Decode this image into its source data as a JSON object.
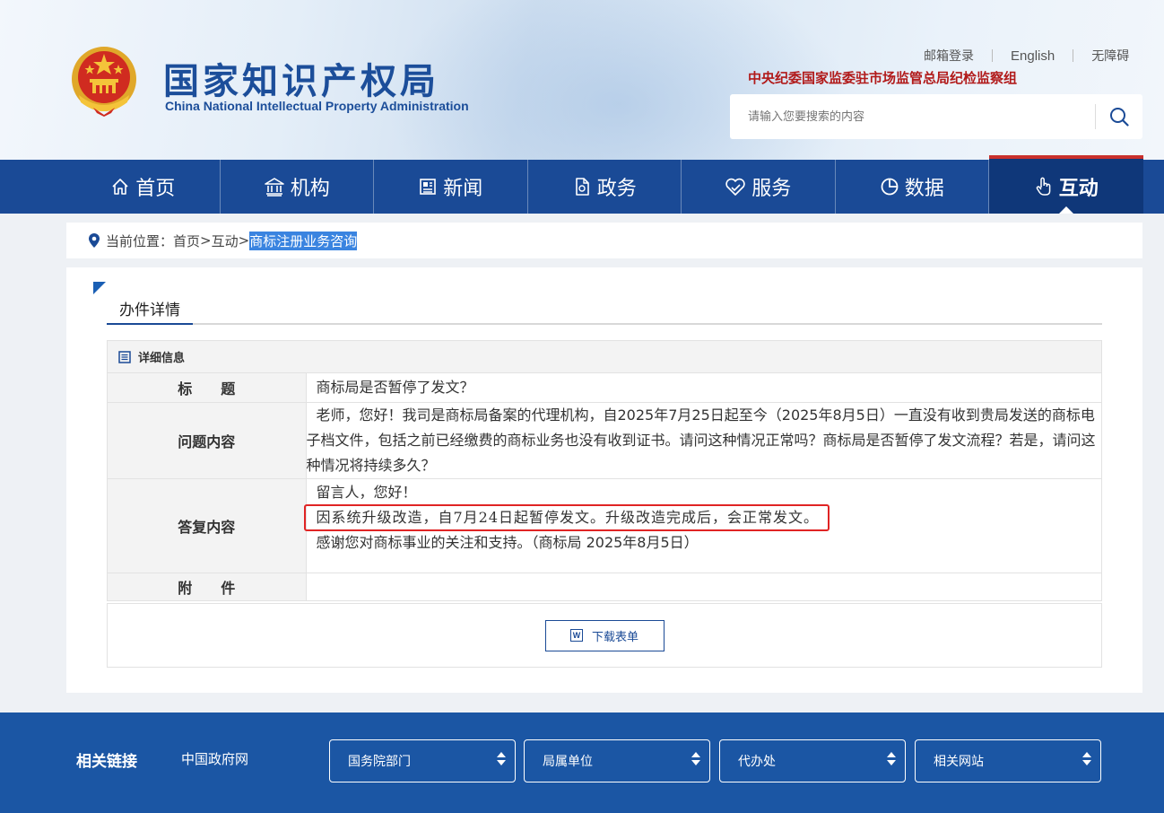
{
  "header": {
    "logo_cn": "国家知识产权局",
    "logo_en": "China National Intellectual Property Administration",
    "top_links": [
      "邮箱登录",
      "English",
      "无障碍"
    ],
    "discipline_group": "中央纪委国家监委驻市场监管总局纪检监察组",
    "search_placeholder": "请输入您要搜索的内容"
  },
  "nav": {
    "items": [
      {
        "label": "首页",
        "icon": "home-icon"
      },
      {
        "label": "机构",
        "icon": "institution-icon"
      },
      {
        "label": "新闻",
        "icon": "news-icon"
      },
      {
        "label": "政务",
        "icon": "document-icon"
      },
      {
        "label": "服务",
        "icon": "heart-hand-icon"
      },
      {
        "label": "数据",
        "icon": "pie-chart-icon"
      },
      {
        "label": "互动",
        "icon": "hand-pointer-icon"
      }
    ],
    "active_index": 6
  },
  "breadcrumb": {
    "prefix": "当前位置：",
    "items": [
      "首页",
      "互动"
    ],
    "separator": ">",
    "current": "商标注册业务咨询"
  },
  "detail": {
    "section_title": "办件详情",
    "panel_title": "详细信息",
    "rows": {
      "title_label": "标　　题",
      "title_value": "商标局是否暂停了发文？",
      "question_label": "问题内容",
      "question_value": "老师，您好！我司是商标局备案的代理机构，自2025年7月25日起至今（2025年8月5日）一直没有收到贵局发送的商标电子档文件，包括之前已经缴费的商标业务也没有收到证书。请问这种情况正常吗？商标局是否暂停了发文流程？若是，请问这种情况将持续多久？",
      "answer_label": "答复内容",
      "answer_greeting": "留言人，您好！",
      "answer_highlight": "因系统升级改造，自7月24日起暂停发文。升级改造完成后，会正常发文。",
      "answer_closing": "感谢您对商标事业的关注和支持。（商标局 2025年8月5日）",
      "attachment_label": "附　　件",
      "attachment_value": ""
    },
    "download_label": "下载表单",
    "download_icon_letter": "W"
  },
  "footer": {
    "related_links_label": "相关链接",
    "gov_link": "中国政府网",
    "selects": [
      "国务院部门",
      "局属单位",
      "代办处",
      "相关网站"
    ]
  },
  "colors": {
    "nav_bg": "#1a4a96",
    "brand_blue": "#1c4e9a",
    "alert_red": "#e02424",
    "footer_bg": "#1b56a4"
  }
}
